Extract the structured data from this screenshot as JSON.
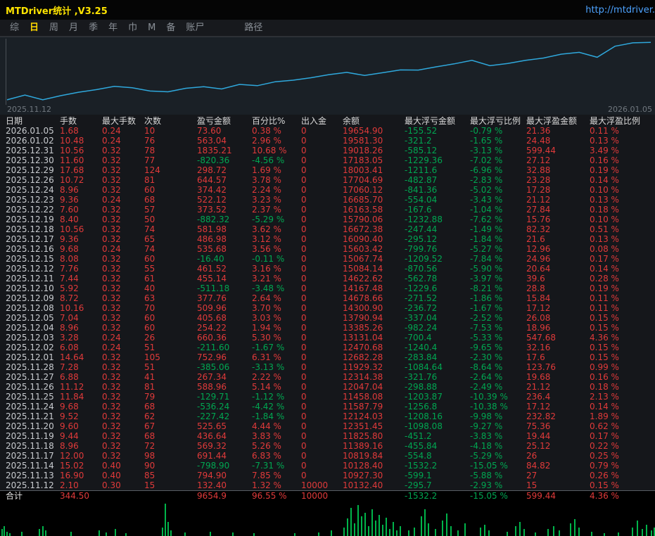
{
  "titlebar": {
    "title": "MTDriver统计 ,V3.25",
    "link": "http://mtdriver."
  },
  "menu": {
    "items": [
      "综",
      "日",
      "周",
      "月",
      "季",
      "年",
      "巾",
      "M",
      "备",
      "账尸",
      "路径"
    ],
    "active_index": 1
  },
  "chart": {
    "start_label": "2025.11.12",
    "end_label": "2026.01.05"
  },
  "colors": {
    "positive": "#e03a3a",
    "negative": "#00a651",
    "line": "#2fa8dc",
    "bar": "#00b44a",
    "accent_yellow": "#ffd800",
    "link_blue": "#4da3ff",
    "title_yellow": "#ffe400"
  },
  "table": {
    "columns": [
      "日期",
      "手数",
      "最大手数",
      "次数",
      "盈亏金额",
      "百分比%",
      "出入金",
      "余额",
      "最大浮亏金额",
      "最大浮亏比例",
      "最大浮盈金额",
      "最大浮盈比例"
    ],
    "rows": [
      [
        "2026.01.05",
        "1.68",
        "0.24",
        "10",
        "73.60",
        "0.38 %",
        "0",
        "19654.90",
        "-155.52",
        "-0.79 %",
        "21.36",
        "0.11 %"
      ],
      [
        "2026.01.02",
        "10.48",
        "0.24",
        "76",
        "563.04",
        "2.96 %",
        "0",
        "19581.30",
        "-321.2",
        "-1.65 %",
        "24.48",
        "0.13 %"
      ],
      [
        "2025.12.31",
        "10.56",
        "0.32",
        "78",
        "1835.21",
        "10.68 %",
        "0",
        "19018.26",
        "-585.12",
        "-3.13 %",
        "599.44",
        "3.49 %"
      ],
      [
        "2025.12.30",
        "11.60",
        "0.32",
        "77",
        "-820.36",
        "-4.56 %",
        "0",
        "17183.05",
        "-1229.36",
        "-7.02 %",
        "27.12",
        "0.16 %"
      ],
      [
        "2025.12.29",
        "17.68",
        "0.32",
        "124",
        "298.72",
        "1.69 %",
        "0",
        "18003.41",
        "-1211.6",
        "-6.96 %",
        "32.88",
        "0.19 %"
      ],
      [
        "2025.12.26",
        "10.72",
        "0.32",
        "81",
        "644.57",
        "3.78 %",
        "0",
        "17704.69",
        "-482.87",
        "-2.83 %",
        "23.28",
        "0.14 %"
      ],
      [
        "2025.12.24",
        "8.96",
        "0.32",
        "60",
        "374.42",
        "2.24 %",
        "0",
        "17060.12",
        "-841.36",
        "-5.02 %",
        "17.28",
        "0.10 %"
      ],
      [
        "2025.12.23",
        "9.36",
        "0.24",
        "68",
        "522.12",
        "3.23 %",
        "0",
        "16685.70",
        "-554.04",
        "-3.43 %",
        "21.12",
        "0.13 %"
      ],
      [
        "2025.12.22",
        "7.60",
        "0.32",
        "57",
        "373.52",
        "2.37 %",
        "0",
        "16163.58",
        "-167.6",
        "-1.04 %",
        "27.84",
        "0.18 %"
      ],
      [
        "2025.12.19",
        "8.40",
        "0.32",
        "50",
        "-882.32",
        "-5.29 %",
        "0",
        "15790.06",
        "-1232.88",
        "-7.62 %",
        "15.76",
        "0.10 %"
      ],
      [
        "2025.12.18",
        "10.56",
        "0.32",
        "74",
        "581.98",
        "3.62 %",
        "0",
        "16672.38",
        "-247.44",
        "-1.49 %",
        "82.32",
        "0.51 %"
      ],
      [
        "2025.12.17",
        "9.36",
        "0.32",
        "65",
        "486.98",
        "3.12 %",
        "0",
        "16090.40",
        "-295.12",
        "-1.84 %",
        "21.6",
        "0.13 %"
      ],
      [
        "2025.12.16",
        "9.68",
        "0.24",
        "74",
        "535.68",
        "3.56 %",
        "0",
        "15603.42",
        "-799.76",
        "-5.27 %",
        "12.96",
        "0.08 %"
      ],
      [
        "2025.12.15",
        "8.08",
        "0.32",
        "60",
        "-16.40",
        "-0.11 %",
        "0",
        "15067.74",
        "-1209.52",
        "-7.84 %",
        "24.96",
        "0.17 %"
      ],
      [
        "2025.12.12",
        "7.76",
        "0.32",
        "55",
        "461.52",
        "3.16 %",
        "0",
        "15084.14",
        "-870.56",
        "-5.90 %",
        "20.64",
        "0.14 %"
      ],
      [
        "2025.12.11",
        "7.44",
        "0.32",
        "61",
        "455.14",
        "3.21 %",
        "0",
        "14622.62",
        "-562.78",
        "-3.97 %",
        "39.6",
        "0.28 %"
      ],
      [
        "2025.12.10",
        "5.92",
        "0.32",
        "40",
        "-511.18",
        "-3.48 %",
        "0",
        "14167.48",
        "-1229.6",
        "-8.21 %",
        "28.8",
        "0.19 %"
      ],
      [
        "2025.12.09",
        "8.72",
        "0.32",
        "63",
        "377.76",
        "2.64 %",
        "0",
        "14678.66",
        "-271.52",
        "-1.86 %",
        "15.84",
        "0.11 %"
      ],
      [
        "2025.12.08",
        "10.16",
        "0.32",
        "70",
        "509.96",
        "3.70 %",
        "0",
        "14300.90",
        "-236.72",
        "-1.67 %",
        "17.12",
        "0.11 %"
      ],
      [
        "2025.12.05",
        "7.04",
        "0.32",
        "60",
        "405.68",
        "3.03 %",
        "0",
        "13790.94",
        "-337.04",
        "-2.52 %",
        "26.08",
        "0.15 %"
      ],
      [
        "2025.12.04",
        "8.96",
        "0.32",
        "60",
        "254.22",
        "1.94 %",
        "0",
        "13385.26",
        "-982.24",
        "-7.53 %",
        "18.96",
        "0.15 %"
      ],
      [
        "2025.12.03",
        "3.28",
        "0.24",
        "26",
        "660.36",
        "5.30 %",
        "0",
        "13131.04",
        "-700.4",
        "-5.33 %",
        "547.68",
        "4.36 %"
      ],
      [
        "2025.12.02",
        "6.08",
        "0.24",
        "51",
        "-211.60",
        "-1.67 %",
        "0",
        "12470.68",
        "-1240.4",
        "-9.65 %",
        "32.16",
        "0.15 %"
      ],
      [
        "2025.12.01",
        "14.64",
        "0.32",
        "105",
        "752.96",
        "6.31 %",
        "0",
        "12682.28",
        "-283.84",
        "-2.30 %",
        "17.6",
        "0.15 %"
      ],
      [
        "2025.11.28",
        "7.28",
        "0.32",
        "51",
        "-385.06",
        "-3.13 %",
        "0",
        "11929.32",
        "-1084.64",
        "-8.64 %",
        "123.76",
        "0.99 %"
      ],
      [
        "2025.11.27",
        "6.88",
        "0.32",
        "41",
        "267.34",
        "2.22 %",
        "0",
        "12314.38",
        "-321.76",
        "-2.64 %",
        "19.68",
        "0.16 %"
      ],
      [
        "2025.11.26",
        "11.12",
        "0.32",
        "81",
        "588.96",
        "5.14 %",
        "0",
        "12047.04",
        "-298.88",
        "-2.49 %",
        "21.12",
        "0.18 %"
      ],
      [
        "2025.11.25",
        "11.84",
        "0.32",
        "79",
        "-129.71",
        "-1.12 %",
        "0",
        "11458.08",
        "-1203.87",
        "-10.39 %",
        "236.4",
        "2.13 %"
      ],
      [
        "2025.11.24",
        "9.68",
        "0.32",
        "68",
        "-536.24",
        "-4.42 %",
        "0",
        "11587.79",
        "-1256.8",
        "-10.38 %",
        "17.12",
        "0.14 %"
      ],
      [
        "2025.11.21",
        "9.52",
        "0.32",
        "62",
        "-227.42",
        "-1.84 %",
        "0",
        "12124.03",
        "-1208.16",
        "-9.98 %",
        "232.82",
        "1.89 %"
      ],
      [
        "2025.11.20",
        "9.60",
        "0.32",
        "67",
        "525.65",
        "4.44 %",
        "0",
        "12351.45",
        "-1098.08",
        "-9.27 %",
        "75.36",
        "0.62 %"
      ],
      [
        "2025.11.19",
        "9.44",
        "0.32",
        "68",
        "436.64",
        "3.83 %",
        "0",
        "11825.80",
        "-451.2",
        "-3.83 %",
        "19.44",
        "0.17 %"
      ],
      [
        "2025.11.18",
        "8.96",
        "0.32",
        "72",
        "569.32",
        "5.26 %",
        "0",
        "11389.16",
        "-455.84",
        "-4.18 %",
        "25.12",
        "0.22 %"
      ],
      [
        "2025.11.17",
        "12.00",
        "0.32",
        "98",
        "691.44",
        "6.83 %",
        "0",
        "10819.84",
        "-554.8",
        "-5.29 %",
        "26",
        "0.25 %"
      ],
      [
        "2025.11.14",
        "15.02",
        "0.40",
        "90",
        "-798.90",
        "-7.31 %",
        "0",
        "10128.40",
        "-1532.2",
        "-15.05 %",
        "84.82",
        "0.79 %"
      ],
      [
        "2025.11.13",
        "16.90",
        "0.40",
        "85",
        "794.90",
        "7.85 %",
        "0",
        "10927.30",
        "-599.1",
        "-5.88 %",
        "27",
        "0.26 %"
      ],
      [
        "2025.11.12",
        "2.10",
        "0.30",
        "15",
        "132.40",
        "1.32 %",
        "10000",
        "10132.40",
        "-295.7",
        "-2.93 %",
        "15",
        "0.15 %"
      ]
    ],
    "total": [
      "合计",
      "344.50",
      "",
      "",
      "9654.9",
      "96.55 %",
      "10000",
      "",
      "-1532.2",
      "-15.05 %",
      "599.44",
      "4.36 %"
    ]
  },
  "chart_data": [
    {
      "type": "line",
      "title": "账户余额曲线",
      "x_first": "2025.11.12",
      "x_last": "2026.01.05",
      "ylim": [
        10000,
        19800
      ],
      "balance": [
        10132.4,
        10927.3,
        10128.4,
        10819.84,
        11389.16,
        11825.8,
        12351.45,
        12124.03,
        11587.79,
        11458.08,
        12047.04,
        12314.38,
        11929.32,
        12682.28,
        12470.68,
        13131.04,
        13385.26,
        13790.94,
        14300.9,
        14678.66,
        14167.48,
        14622.62,
        15084.14,
        15067.74,
        15603.42,
        16090.4,
        16672.38,
        15790.06,
        16163.58,
        16685.7,
        17060.12,
        17704.69,
        18003.41,
        17183.05,
        19018.26,
        19581.3,
        19654.9
      ]
    },
    {
      "type": "bar",
      "title": "底部成交量柱状图",
      "volume_bars": [
        [
          2,
          10
        ],
        [
          5,
          14
        ],
        [
          9,
          6
        ],
        [
          13,
          4
        ],
        [
          30,
          6
        ],
        [
          55,
          10
        ],
        [
          60,
          14
        ],
        [
          64,
          8
        ],
        [
          100,
          6
        ],
        [
          140,
          8
        ],
        [
          150,
          5
        ],
        [
          163,
          10
        ],
        [
          178,
          4
        ],
        [
          230,
          12
        ],
        [
          234,
          46
        ],
        [
          238,
          20
        ],
        [
          242,
          8
        ],
        [
          262,
          5
        ],
        [
          298,
          6
        ],
        [
          330,
          5
        ],
        [
          360,
          4
        ],
        [
          418,
          4
        ],
        [
          452,
          5
        ],
        [
          470,
          8
        ],
        [
          488,
          12
        ],
        [
          493,
          25
        ],
        [
          498,
          40
        ],
        [
          503,
          18
        ],
        [
          508,
          44
        ],
        [
          513,
          28
        ],
        [
          518,
          33
        ],
        [
          523,
          14
        ],
        [
          528,
          38
        ],
        [
          533,
          22
        ],
        [
          538,
          30
        ],
        [
          543,
          16
        ],
        [
          548,
          26
        ],
        [
          553,
          10
        ],
        [
          558,
          20
        ],
        [
          563,
          8
        ],
        [
          568,
          14
        ],
        [
          580,
          8
        ],
        [
          588,
          12
        ],
        [
          598,
          28
        ],
        [
          603,
          38
        ],
        [
          608,
          18
        ],
        [
          618,
          10
        ],
        [
          628,
          22
        ],
        [
          634,
          32
        ],
        [
          640,
          14
        ],
        [
          650,
          8
        ],
        [
          660,
          18
        ],
        [
          682,
          12
        ],
        [
          688,
          16
        ],
        [
          694,
          8
        ],
        [
          720,
          6
        ],
        [
          732,
          14
        ],
        [
          738,
          20
        ],
        [
          744,
          10
        ],
        [
          760,
          5
        ],
        [
          778,
          10
        ],
        [
          786,
          14
        ],
        [
          794,
          8
        ],
        [
          810,
          18
        ],
        [
          816,
          24
        ],
        [
          822,
          12
        ],
        [
          840,
          6
        ],
        [
          858,
          4
        ],
        [
          878,
          5
        ],
        [
          898,
          12
        ],
        [
          905,
          22
        ],
        [
          912,
          10
        ],
        [
          918,
          16
        ],
        [
          925,
          8
        ],
        [
          929,
          12
        ]
      ]
    }
  ]
}
